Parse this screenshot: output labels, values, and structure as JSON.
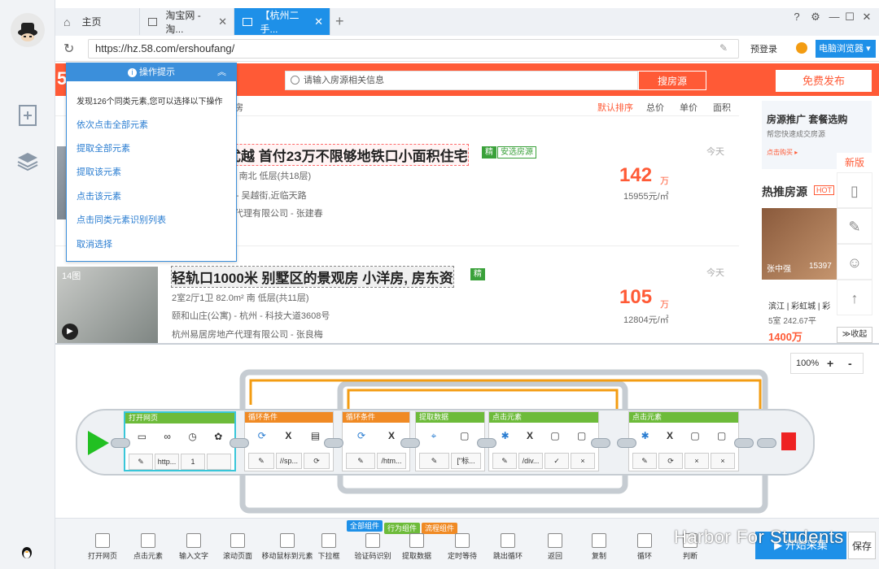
{
  "tabs": [
    {
      "label": "主页"
    },
    {
      "label": "淘宝网 - 淘..."
    },
    {
      "label": "【杭州二手..."
    }
  ],
  "address": {
    "url": "https://hz.58.com/ershoufang/",
    "login": "预登录",
    "browser_mode": "电脑浏览器"
  },
  "site": {
    "logo": "58",
    "search_placeholder": "请输入房源相关信息",
    "search_button": "搜房源",
    "publish_button": "免费发布",
    "filter_text": "房",
    "sort": [
      "默认排序",
      "总价",
      "单价",
      "面积"
    ]
  },
  "popup": {
    "title": "操作提示",
    "found_text": "发现126个同类元素,您可以选择以下操作",
    "items": [
      "依次点击全部元素",
      "提取全部元素",
      "提取该元素",
      "点击该元素",
      "点击同类元素识别列表",
      "取消选择"
    ]
  },
  "listings": [
    {
      "title": "临安佳源优越 首付23万不限够地铁口小面积住宅",
      "tag1": "精",
      "tag2": "安选房源",
      "meta1": "2室1厅1卫    80m²    南北    低层(共18层)",
      "meta2": "杭州佳源 - 临安 - 吴越街,近临天路",
      "meta3": "杭州家居房地产代理有限公司 - 张建春",
      "price": "142",
      "unit": "万",
      "uprice": "15955元/㎡",
      "date": "今天"
    },
    {
      "title": "轻轨口1000米 别墅区的景观房 小洋房, 房东资",
      "tag1": "精",
      "meta1": "2室2厅1卫    82.0m²    南    低层(共11层)",
      "meta2": "颐和山庄(公寓) - 杭州 - 科技大道3608号",
      "meta3": "杭州易居房地产代理有限公司 - 张良梅",
      "photo_count": "14图",
      "price": "105",
      "unit": "万",
      "uprice": "12804元/㎡",
      "date": "今天"
    }
  ],
  "sidebar_ad": {
    "title": "房源推广 套餐选购",
    "subtitle": "帮您快速成交房源",
    "link": "点击购买 ▸"
  },
  "hot": {
    "title": "热推房源",
    "badge": "HOT",
    "new": "新版",
    "name": "张中强",
    "price_part": "15397",
    "place": "滨江 | 彩虹城 | 彩",
    "info": "5室   242.67平",
    "price": "1400万"
  },
  "collapse": "收起",
  "zoom": {
    "value": "100%",
    "plus": "+",
    "minus": "-"
  },
  "flow_nodes": [
    {
      "title": "打开网页",
      "fields": [
        "http...",
        "1"
      ]
    },
    {
      "title": "循环条件",
      "fields": [
        "//sp...",
        ""
      ]
    },
    {
      "title": "循环条件",
      "fields": [
        "/htm...",
        ""
      ]
    },
    {
      "title": "提取数据",
      "fields": [
        "[\"标..."
      ]
    },
    {
      "title": "点击元素",
      "fields": [
        "/div...",
        "✓",
        "×"
      ]
    },
    {
      "title": "点击元素",
      "fields": [
        "",
        "×",
        "×"
      ]
    }
  ],
  "toolbar": {
    "chips": [
      "全部组件",
      "行为组件",
      "流程组件"
    ],
    "items": [
      "打开网页",
      "点击元素",
      "输入文字",
      "滚动页面",
      "移动鼠标到元素",
      "下拉框",
      "验证码识别",
      "提取数据",
      "定时等待",
      "跳出循环",
      "返回",
      "复制",
      "循环",
      "判断"
    ],
    "start": "开始采集",
    "save": "保存"
  },
  "watermark": "Harbor For Students"
}
